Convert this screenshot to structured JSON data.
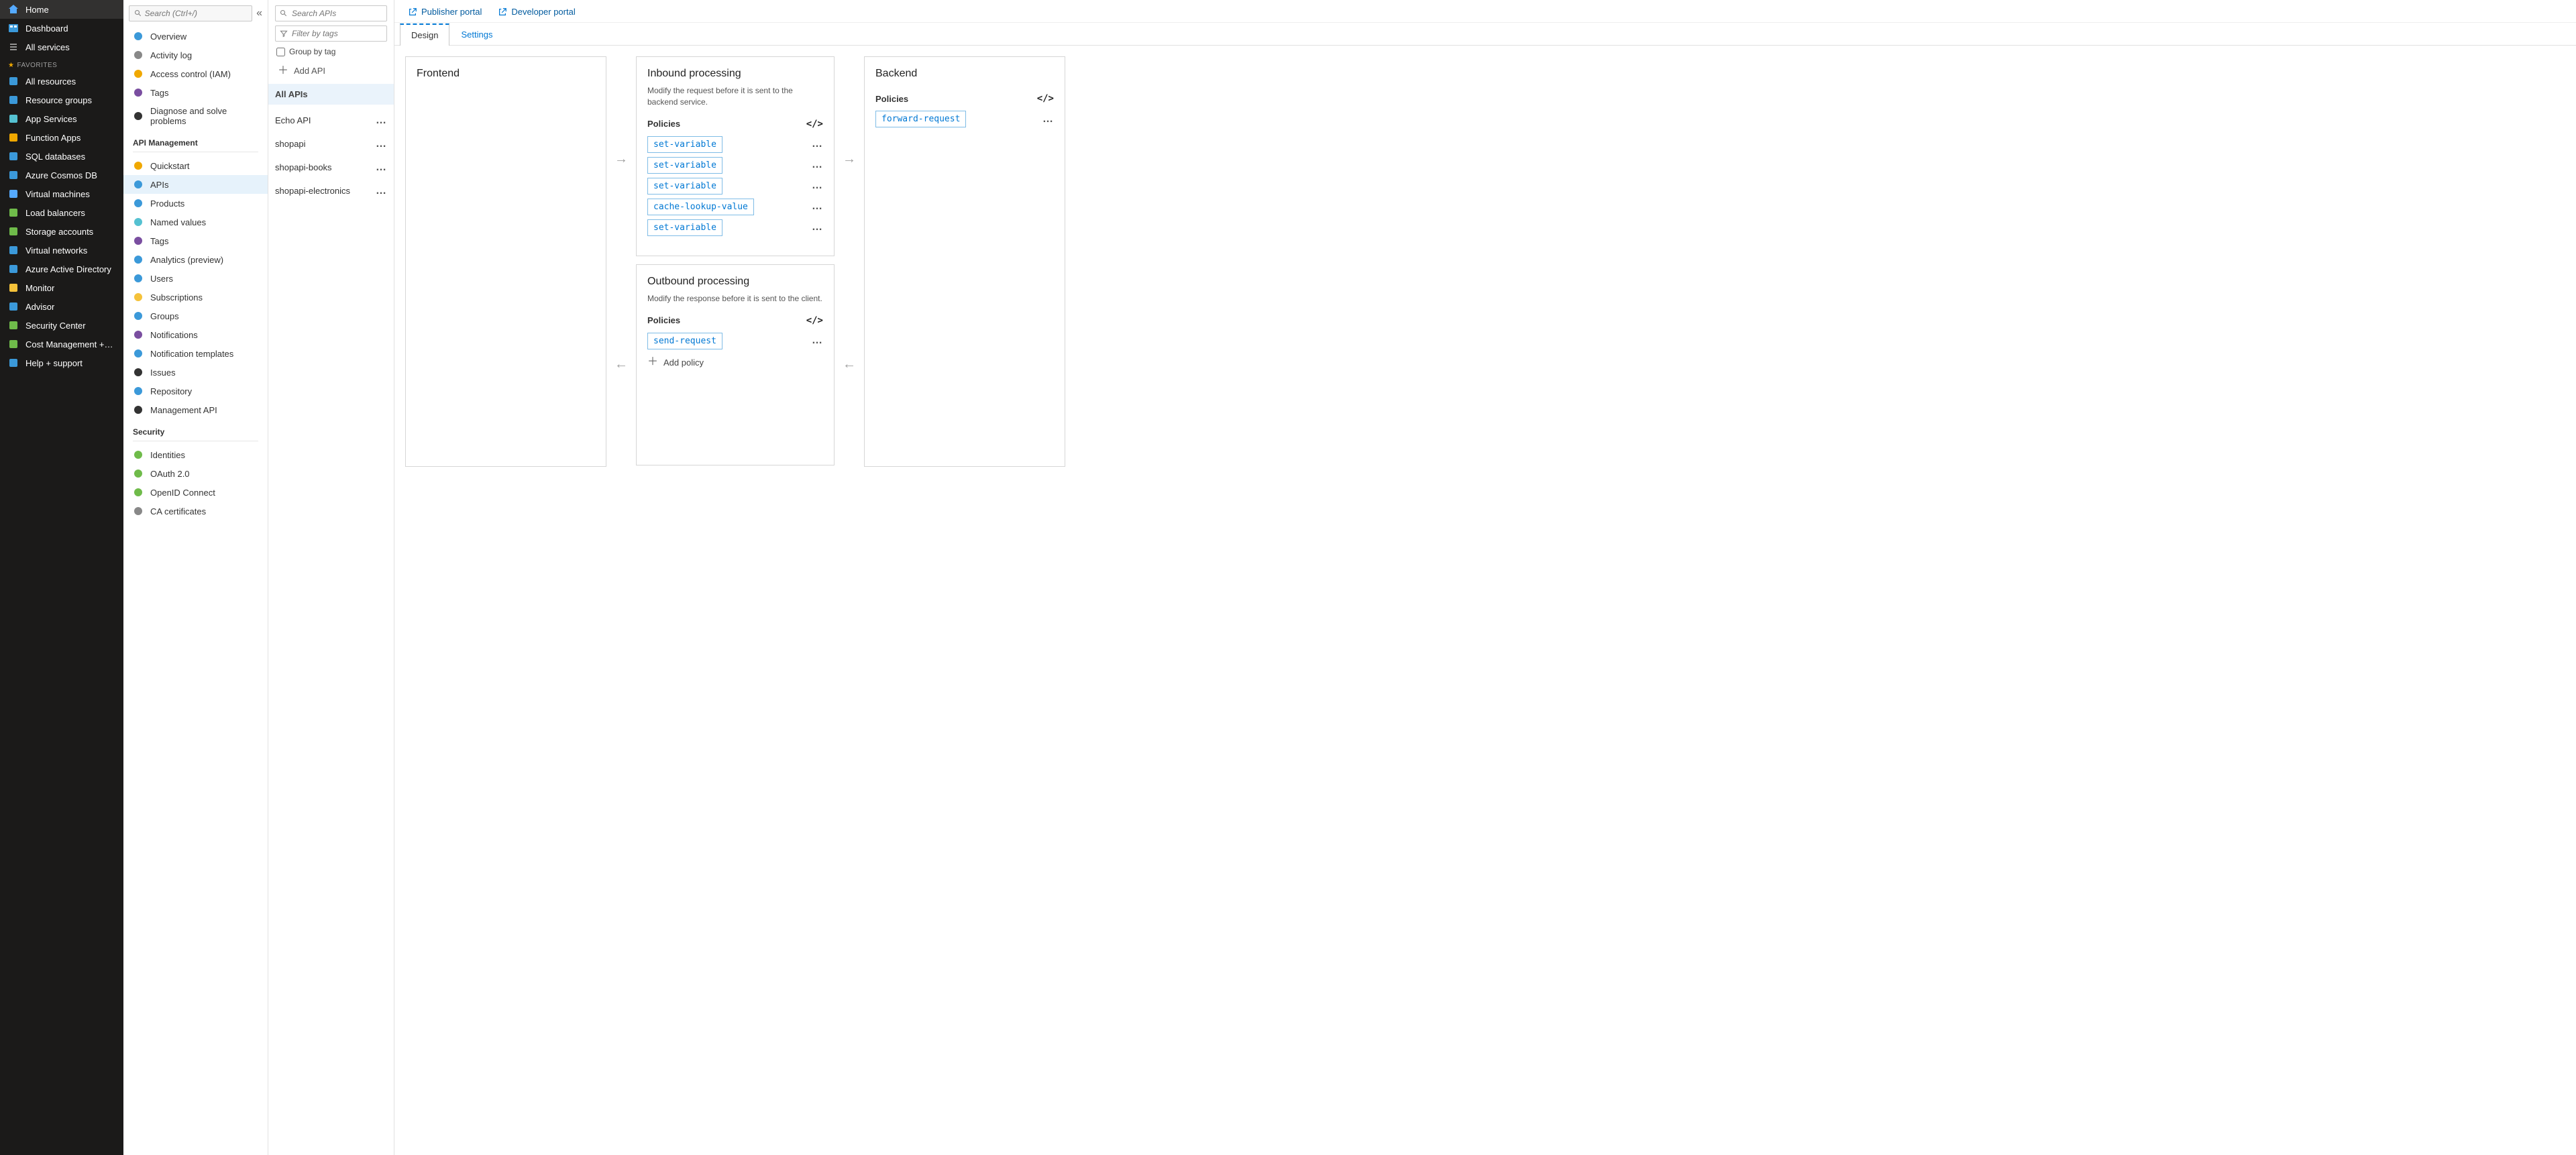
{
  "leftnav": {
    "home": "Home",
    "dashboard": "Dashboard",
    "all_services": "All services",
    "favorites_header": "FAVORITES",
    "items": [
      "All resources",
      "Resource groups",
      "App Services",
      "Function Apps",
      "SQL databases",
      "Azure Cosmos DB",
      "Virtual machines",
      "Load balancers",
      "Storage accounts",
      "Virtual networks",
      "Azure Active Directory",
      "Monitor",
      "Advisor",
      "Security Center",
      "Cost Management + Billing",
      "Help + support"
    ]
  },
  "blade": {
    "search_placeholder": "Search (Ctrl+/)",
    "top": [
      "Overview",
      "Activity log",
      "Access control (IAM)",
      "Tags",
      "Diagnose and solve problems"
    ],
    "section_api": "API Management",
    "api_items": [
      "Quickstart",
      "APIs",
      "Products",
      "Named values",
      "Tags",
      "Analytics (preview)",
      "Users",
      "Subscriptions",
      "Groups",
      "Notifications",
      "Notification templates",
      "Issues",
      "Repository",
      "Management API"
    ],
    "section_security": "Security",
    "security_items": [
      "Identities",
      "OAuth 2.0",
      "OpenID Connect",
      "CA certificates"
    ]
  },
  "apicol": {
    "search_placeholder": "Search APIs",
    "filter_placeholder": "Filter by tags",
    "group_by_tag": "Group by tag",
    "add_api": "Add API",
    "all_apis": "All APIs",
    "apis": [
      "Echo API",
      "shopapi",
      "shopapi-books",
      "shopapi-electronics"
    ]
  },
  "portals": {
    "publisher": "Publisher portal",
    "developer": "Developer portal"
  },
  "tabs": {
    "design": "Design",
    "settings": "Settings"
  },
  "frontend": {
    "title": "Frontend"
  },
  "inbound": {
    "title": "Inbound processing",
    "desc": "Modify the request before it is sent to the backend service.",
    "policies_label": "Policies",
    "policies": [
      "set-variable",
      "set-variable",
      "set-variable",
      "cache-lookup-value",
      "set-variable"
    ]
  },
  "outbound": {
    "title": "Outbound processing",
    "desc": "Modify the response before it is sent to the client.",
    "policies_label": "Policies",
    "policies": [
      "send-request"
    ],
    "add_policy": "Add policy"
  },
  "backend": {
    "title": "Backend",
    "policies_label": "Policies",
    "policies": [
      "forward-request"
    ]
  },
  "colors": {
    "accent": "#0078d4",
    "nav_bg": "#1b1a19"
  }
}
